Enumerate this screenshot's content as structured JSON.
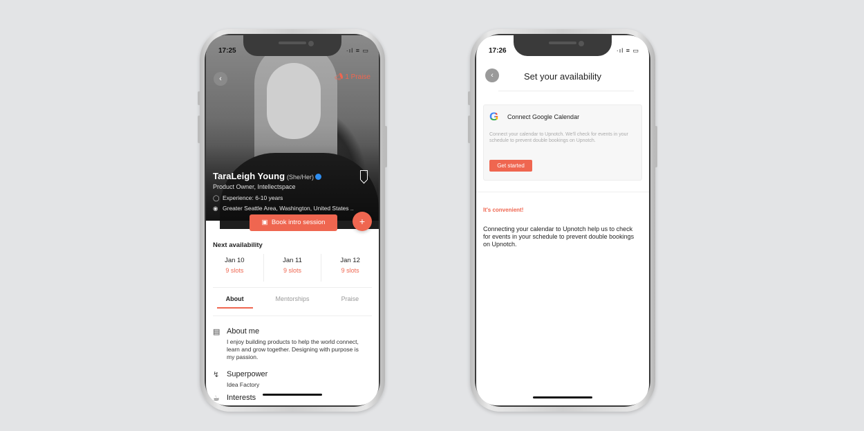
{
  "phone1": {
    "time": "17:25",
    "status_icons": "·ıl ≡ ▭",
    "praise": "1 Praise",
    "name": "TaraLeigh Young",
    "pronouns": "(She/Her)",
    "role": "Product Owner, Intellectspace",
    "experience": "Experience: 6-10 years",
    "location": "Greater Seattle Area, Washington, United States ..",
    "book_button": "Book intro session",
    "next_availability": "Next availability",
    "slots": [
      {
        "date": "Jan 10",
        "slots": "9 slots"
      },
      {
        "date": "Jan 11",
        "slots": "9 slots"
      },
      {
        "date": "Jan 12",
        "slots": "9 slots"
      }
    ],
    "tabs": [
      "About",
      "Mentorships",
      "Praise"
    ],
    "about_title": "About me",
    "about_body": "I enjoy building products to help the world connect, learn and grow together. Designing with purpose is my passion.",
    "superpower_title": "Superpower",
    "superpower_body": "Idea Factory",
    "interests_title": "Interests"
  },
  "phone2": {
    "time": "17:26",
    "status_icons": "·ıl ≡ ▭",
    "title": "Set your availability",
    "card_title": "Connect Google Calendar",
    "card_body": "Connect your calendar to Upnotch. We'll check for events in your schedule to prevent double bookings on Upnotch.",
    "card_button": "Get started",
    "convenient_title": "It's convenient!",
    "convenient_body": "Connecting your calendar to Upnotch help us to check for events in your schedule to prevent double bookings on Upnotch."
  },
  "colors": {
    "accent": "#ef6650",
    "verified": "#2e8df0"
  },
  "icons": [
    "back-icon",
    "megaphone-icon",
    "bookmark-icon",
    "verified-icon",
    "award-icon",
    "location-icon",
    "calendar-icon",
    "plus-icon",
    "document-icon",
    "lightning-icon",
    "cup-icon",
    "google-icon"
  ]
}
